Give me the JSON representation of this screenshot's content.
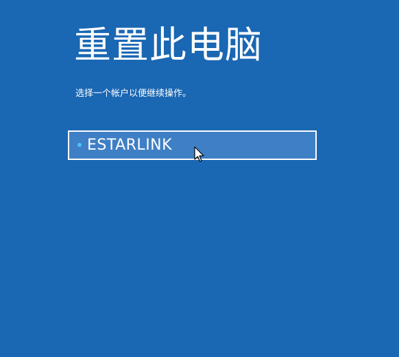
{
  "page": {
    "title": "重置此电脑",
    "subtitle": "选择一个帐户以便继续操作。"
  },
  "accounts": [
    {
      "name": "ESTARLINK",
      "indicator_color": "#4fc3f7"
    }
  ],
  "colors": {
    "background": "#1a67b3",
    "account_highlight": "#3f7fc5",
    "text": "#ffffff"
  },
  "icons": {
    "pointer": "mouse-cursor-icon",
    "indicator": "dot-icon"
  }
}
